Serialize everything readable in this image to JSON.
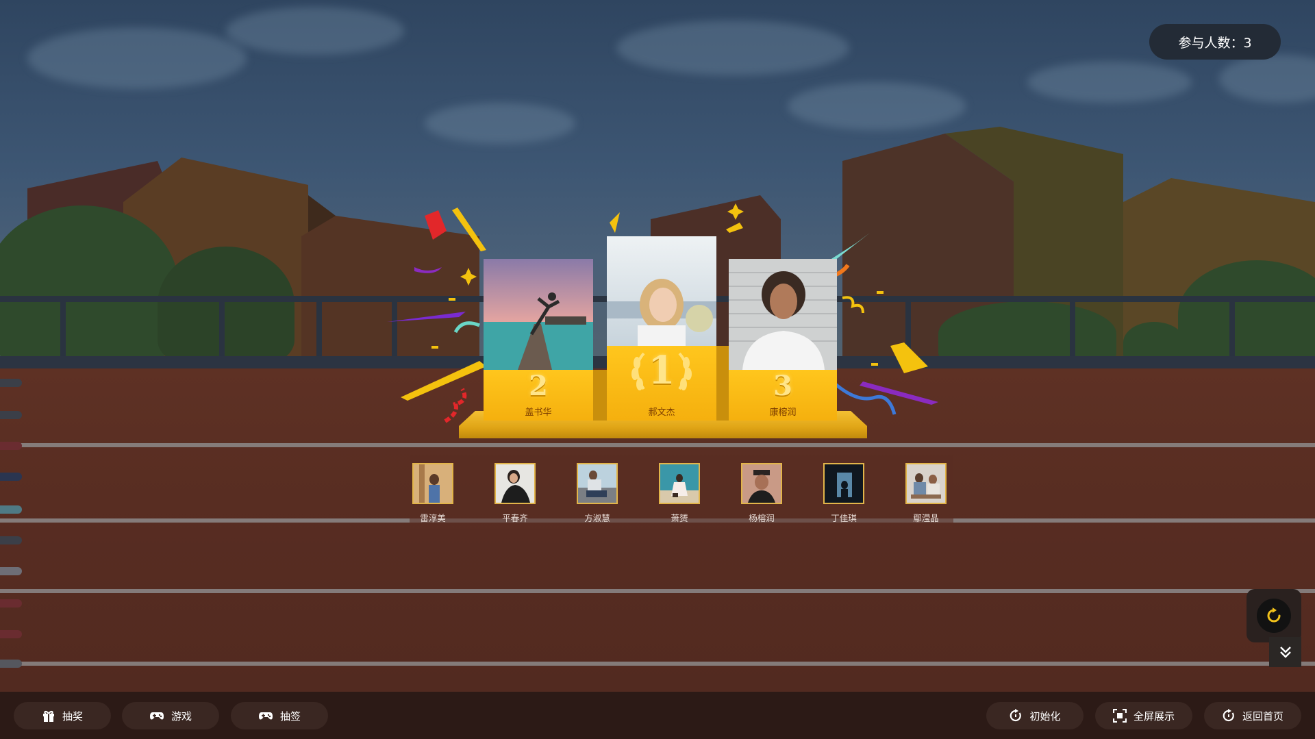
{
  "header": {
    "participant_count": "参与人数：3"
  },
  "podium": {
    "first": {
      "rank": "1",
      "name": "郝文杰"
    },
    "second": {
      "rank": "2",
      "name": "盖书华"
    },
    "third": {
      "rank": "3",
      "name": "康榕润"
    }
  },
  "participants": [
    {
      "name": "雷淳美"
    },
    {
      "name": "平春齐"
    },
    {
      "name": "方淑慧"
    },
    {
      "name": "萧赟"
    },
    {
      "name": "杨榕润"
    },
    {
      "name": "丁佳琪"
    },
    {
      "name": "鄢滢晶"
    }
  ],
  "toolbar_left": {
    "lottery_label": "抽奖",
    "game_label": "游戏",
    "draw_label": "抽签"
  },
  "toolbar_right": {
    "init_label": "初始化",
    "fullscreen_label": "全屏展示",
    "home_label": "返回首页"
  },
  "colors": {
    "podium_gold": "#f5b00e",
    "accent_yellow": "#f2c21b",
    "track": "#5a2f22"
  }
}
